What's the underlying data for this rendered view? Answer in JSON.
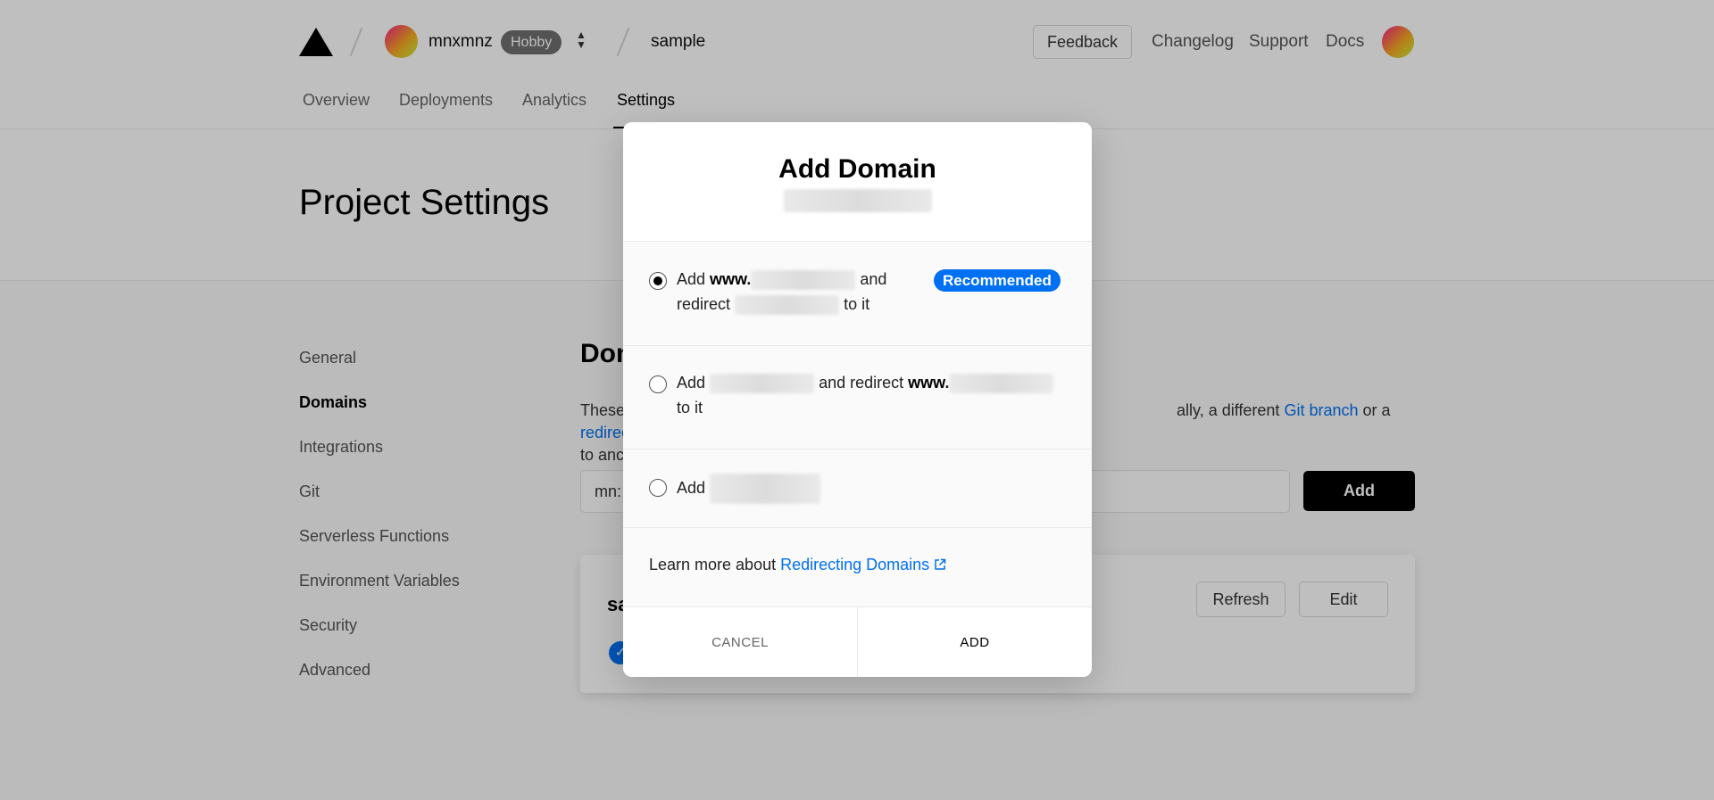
{
  "header": {
    "team_name": "mnxmnz",
    "plan_badge": "Hobby",
    "project_name": "sample",
    "feedback_label": "Feedback",
    "links": [
      "Changelog",
      "Support",
      "Docs"
    ]
  },
  "tabs": [
    "Overview",
    "Deployments",
    "Analytics",
    "Settings"
  ],
  "active_tab": "Settings",
  "page_title": "Project Settings",
  "sidebar": {
    "items": [
      "General",
      "Domains",
      "Integrations",
      "Git",
      "Serverless Functions",
      "Environment Variables",
      "Security",
      "Advanced"
    ],
    "active": "Domains"
  },
  "main": {
    "section_title_partial": "Dom",
    "desc_line1_start": "These",
    "desc_line1_end": "ally, a different ",
    "git_branch_link": "Git branch",
    "desc_or": " or a ",
    "redirection_link": "redirection",
    "desc_line2": "to anc",
    "input_value_partial": "mn:",
    "add_button": "Add",
    "card_name_partial": "sa",
    "refresh_button": "Refresh",
    "edit_button": "Edit"
  },
  "modal": {
    "title": "Add Domain",
    "options": [
      {
        "add": "Add",
        "www": "www.",
        "and": "and",
        "redirect": "redirect",
        "to_it": "to it",
        "badge": "Recommended",
        "selected": true
      },
      {
        "add": "Add",
        "and_redirect": "and redirect",
        "www": "www.",
        "to_it": "to it",
        "selected": false
      },
      {
        "add": "Add",
        "selected": false
      }
    ],
    "learn_more_text": "Learn more about",
    "learn_more_link": "Redirecting Domains",
    "cancel_label": "CANCEL",
    "add_label": "ADD"
  },
  "colors": {
    "accent": "#0070f3",
    "primary_button": "#000000",
    "overlay": "rgba(0,0,0,0.25)"
  },
  "icons": [
    "vercel-logo-icon",
    "chevron-updown-icon",
    "external-link-icon",
    "check-icon"
  ]
}
